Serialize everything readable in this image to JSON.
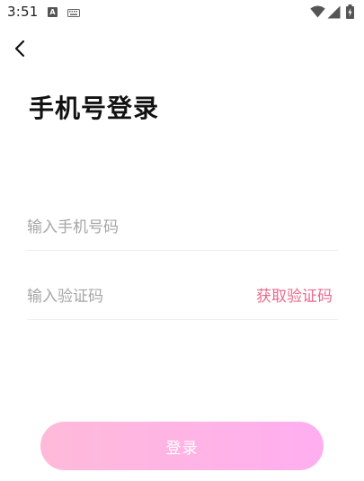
{
  "status_bar": {
    "time": "3:51",
    "notification_letter": "A",
    "icons": [
      "keyboard-icon",
      "wifi-icon",
      "signal-icon",
      "battery-icon"
    ]
  },
  "header": {
    "back_icon": "chevron-left-icon",
    "title": "手机号登录"
  },
  "form": {
    "phone_placeholder": "输入手机号码",
    "code_placeholder": "输入验证码",
    "get_code_label": "获取验证码"
  },
  "login_button": {
    "label": "登录"
  },
  "colors": {
    "accent": "#ec6a8d",
    "button_gradient_start": "#ffbad9",
    "button_gradient_end": "#ffaef0",
    "placeholder": "#a6a6a6"
  }
}
